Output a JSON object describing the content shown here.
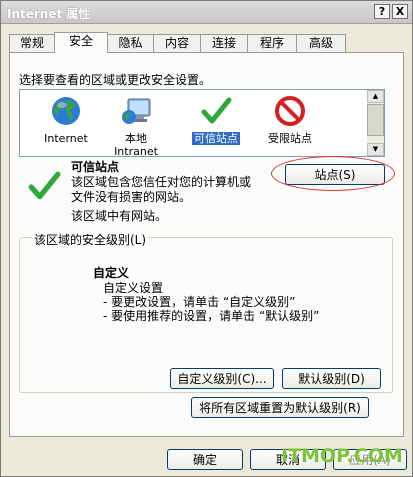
{
  "window": {
    "title": "Internet 属性",
    "help_btn": "?",
    "close_btn": "X"
  },
  "tabs": [
    "常规",
    "安全",
    "隐私",
    "内容",
    "连接",
    "程序",
    "高级"
  ],
  "instruction": "选择要查看的区域或更改安全设置。",
  "zones": [
    {
      "label": "Internet",
      "icon": "globe-icon"
    },
    {
      "label": "本地\nIntranet",
      "label_l1": "本地",
      "label_l2": "Intranet",
      "icon": "monitor-globe-icon"
    },
    {
      "label": "可信站点",
      "icon": "checkmark-icon",
      "selected": true
    },
    {
      "label": "受限站点",
      "icon": "no-entry-icon"
    }
  ],
  "zone_info": {
    "title": "可信站点",
    "desc_l1": "该区域包含您信任对您的计算机或",
    "desc_l2": "文件没有损害的网站。",
    "note": "该区域中有网站。",
    "sites_button": "站点(S)"
  },
  "security_level": {
    "group_label": "该区域的安全级别(L)",
    "level_title": "自定义",
    "line1": "自定义设置",
    "line2": "- 要更改设置，请单击 “自定义级别”",
    "line3": "- 要使用推荐的设置，请单击 “默认级别”",
    "custom_button": "自定义级别(C)...",
    "default_button": "默认级别(D)",
    "reset_all_button": "将所有区域重置为默认级别(R)"
  },
  "footer": {
    "ok": "确定",
    "cancel": "取消",
    "apply": "应用(A)"
  },
  "watermark": "ITMOP.COM",
  "colors": {
    "dialog_bg": "#ece9d8",
    "selection": "#316ac5",
    "annotation_oval": "#e03030",
    "watermark": "#7cc33a"
  }
}
